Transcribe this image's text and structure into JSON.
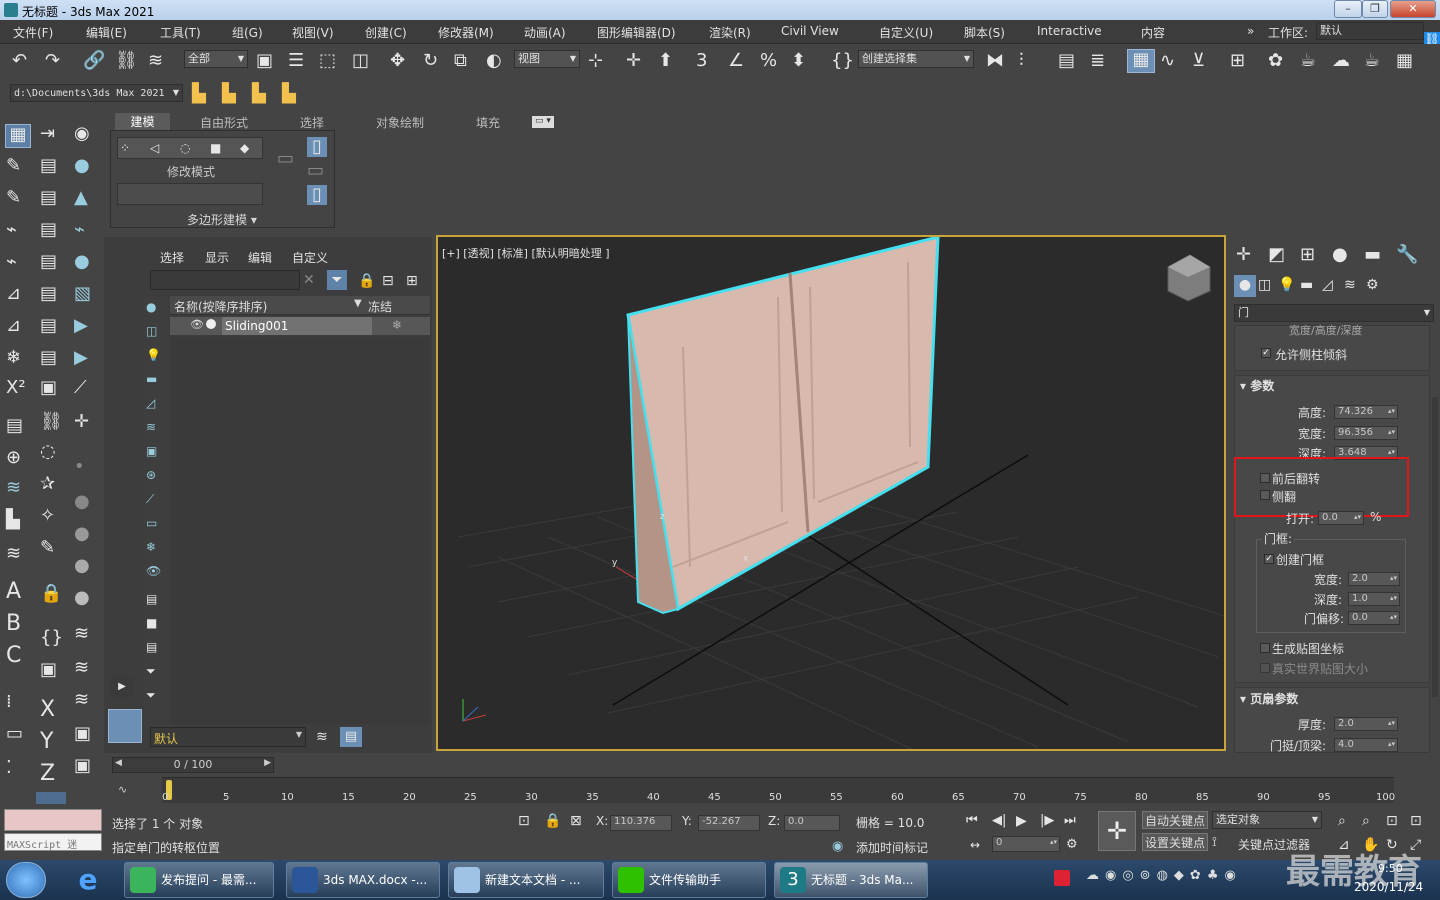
{
  "window": {
    "title": "无标题 - 3ds Max 2021"
  },
  "menu": [
    "文件(F)",
    "编辑(E)",
    "工具(T)",
    "组(G)",
    "视图(V)",
    "创建(C)",
    "修改器(M)",
    "动画(A)",
    "图形编辑器(D)",
    "渲染(R)",
    "Civil View",
    "自定义(U)",
    "脚本(S)",
    "Interactive",
    "内容"
  ],
  "workspace": {
    "label": "工作区:",
    "value": "默认"
  },
  "toolbar": {
    "selection_filter": "全部",
    "ref_coord": "视图",
    "named_selection": "创建选择集",
    "project_path": "d:\\Documents\\3ds Max 2021"
  },
  "ribbon": {
    "tabs": [
      "建模",
      "自由形式",
      "选择",
      "对象绘制",
      "填充"
    ],
    "active_tab": "建模",
    "group_label": "修改模式",
    "panel_label": "多边形建模"
  },
  "scene_explorer": {
    "menu": [
      "选择",
      "显示",
      "编辑",
      "自定义"
    ],
    "col_name": "名称(按降序排序)",
    "col_freeze": "冻结",
    "rows": [
      {
        "name": "Sliding001"
      }
    ],
    "layer": "默认"
  },
  "viewport": {
    "label": "[+] [透视] [标准] [默认明暗处理 ]",
    "object_color": "#d7b9ad",
    "select_color": "#44e0f0",
    "axis_labels": [
      "z",
      "y",
      "x"
    ]
  },
  "command_panel": {
    "object_type": "门",
    "partial_top": "宽度/高度/深度",
    "allow_side": "允许侧柱倾斜",
    "params_title": "参数",
    "height_label": "高度:",
    "height": "74.326",
    "width_label": "宽度:",
    "width": "96.356",
    "depth_label": "深度:",
    "depth": "3.648",
    "flip_swing": "前后翻转",
    "flip_hinge": "侧翻",
    "open_label": "打开:",
    "open": "0.0",
    "open_unit": "%",
    "frame_title": "门框:",
    "create_frame": "创建门框",
    "frame_width_label": "宽度:",
    "frame_width": "2.0",
    "frame_depth_label": "深度:",
    "frame_depth": "1.0",
    "door_offset_label": "门偏移:",
    "door_offset": "0.0",
    "gen_map": "生成贴图坐标",
    "real_world": "真实世界贴图大小",
    "leaf_title": "页扇参数",
    "thickness_label": "厚度:",
    "thickness": "2.0",
    "stile_label": "门挺/顶梁:",
    "stile": "4.0"
  },
  "timeline": {
    "frame": "0 / 100",
    "ticks": [
      "0",
      "5",
      "10",
      "15",
      "20",
      "25",
      "30",
      "35",
      "40",
      "45",
      "50",
      "55",
      "60",
      "65",
      "70",
      "75",
      "80",
      "85",
      "90",
      "95",
      "100"
    ]
  },
  "status": {
    "maxscript": "MAXScript 迷",
    "selected": "选择了 1 个 对象",
    "prompt": "指定单门的转枢位置",
    "x_label": "X:",
    "x": "110.376",
    "y_label": "Y:",
    "y": "-52.267",
    "z_label": "Z:",
    "z": "0.0",
    "grid": "栅格 = 10.0",
    "add_time_tag": "添加时间标记",
    "auto_key": "自动关键点",
    "selected_obj": "选定对象",
    "set_key": "设置关键点",
    "key_filter": "关键点过滤器",
    "frame_field": "0"
  },
  "taskbar": {
    "items": [
      "发布提问 - 最需...",
      "3ds MAX.docx -...",
      "新建文本文档 - ...",
      "文件传输助手",
      "无标题 - 3ds Ma..."
    ],
    "time": "9:50",
    "date": "2020/11/24",
    "watermark": "最需教育"
  }
}
